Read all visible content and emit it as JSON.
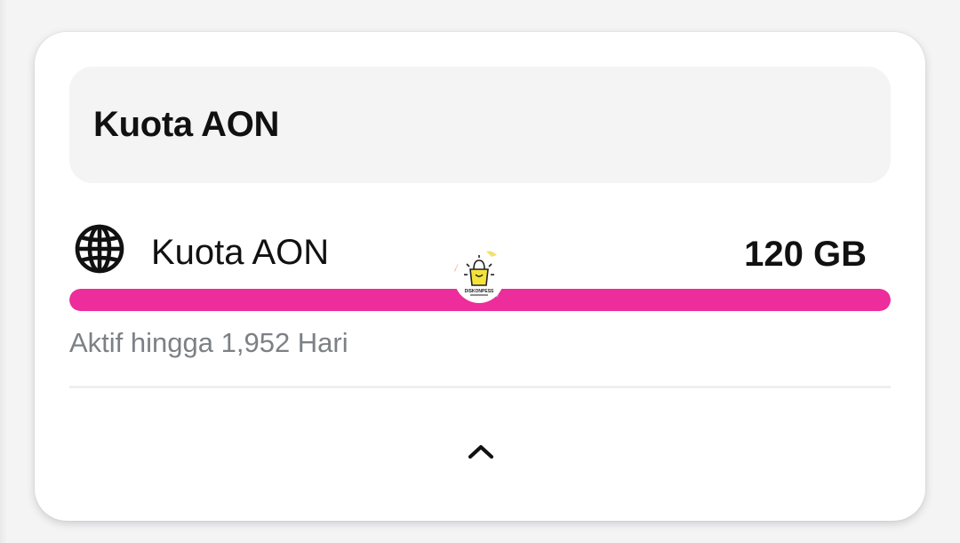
{
  "card": {
    "header_title": "Kuota AON",
    "quota": {
      "icon": "globe-icon",
      "label": "Kuota AON",
      "value": "120 GB",
      "progress_fraction": 1.0,
      "progress_color": "#ec2d9b",
      "expiry": "Aktif hingga 1,952 Hari"
    },
    "collapse_icon": "chevron-up-icon",
    "watermark": {
      "icon": "shopping-bag-logo",
      "text": "DISKONPESS"
    }
  }
}
